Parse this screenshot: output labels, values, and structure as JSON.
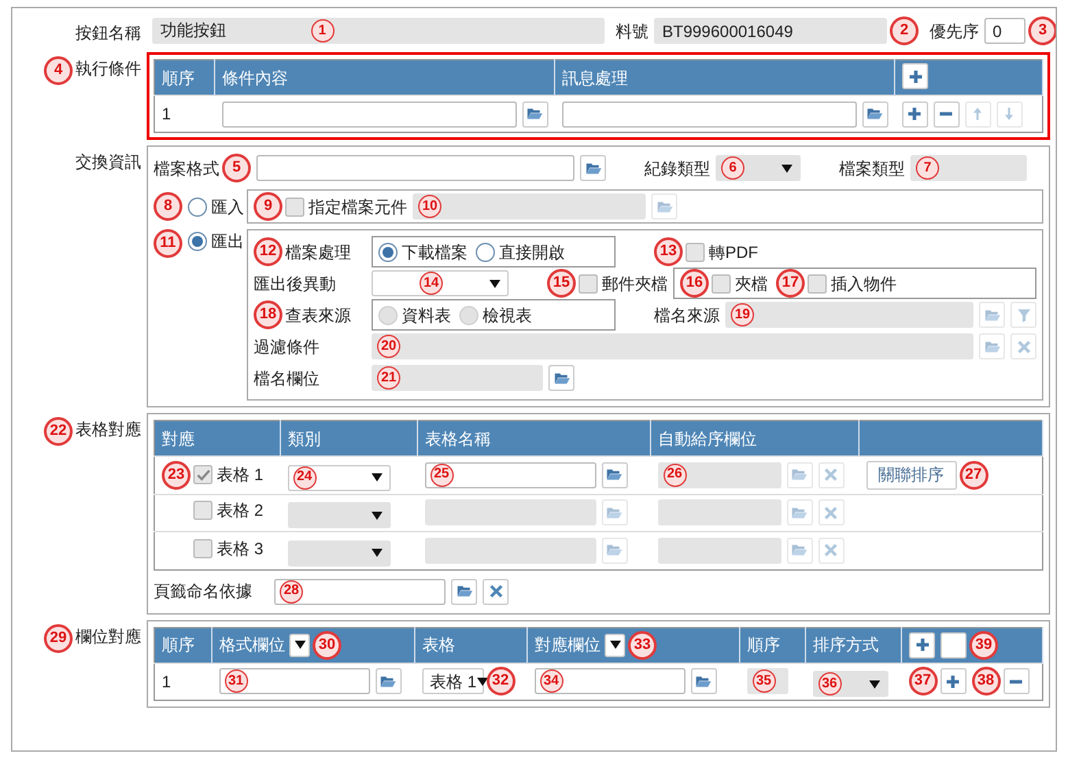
{
  "header": {
    "button_name": {
      "label": "按鈕名稱",
      "value": "功能按鈕",
      "callout": "1",
      "disabled": true
    },
    "item_no": {
      "label": "料號",
      "value": "BT999600016049",
      "callout": "2",
      "disabled": true
    },
    "priority": {
      "label": "優先序",
      "value": "0",
      "callout": "3",
      "disabled": false
    }
  },
  "conditions": {
    "label": "執行條件",
    "callout": "4",
    "columns": [
      "順序",
      "條件內容",
      "訊息處理"
    ],
    "rows": [
      {
        "seq": "1"
      }
    ]
  },
  "exchange": {
    "label": "交換資訊",
    "file_format": {
      "label": "檔案格式",
      "callout": "5"
    },
    "record_type": {
      "label": "紀錄類型",
      "callout": "6",
      "disabled": true
    },
    "file_type": {
      "label": "檔案類型",
      "callout": "7",
      "disabled": true
    },
    "import": {
      "label": "匯入",
      "selected": false,
      "callout": "8",
      "specify_doc": {
        "label": "指定檔案元件",
        "checked": false,
        "callout": "9"
      },
      "doc_field": {
        "callout": "10",
        "disabled": true
      }
    },
    "export": {
      "label": "匯出",
      "selected": true,
      "callout": "11",
      "file_handling": {
        "label": "檔案處理",
        "callout": "12",
        "options": [
          {
            "label": "下載檔案",
            "selected": true
          },
          {
            "label": "直接開啟",
            "selected": false
          }
        ]
      },
      "to_pdf": {
        "label": "轉PDF",
        "checked": false,
        "callout": "13"
      },
      "after_export": {
        "label": "匯出後異動",
        "callout": "14"
      },
      "mail_attach": {
        "label": "郵件夾檔",
        "checked": false,
        "callout": "15",
        "options": [
          {
            "label": "夾檔",
            "checked": false,
            "callout": "16"
          },
          {
            "label": "插入物件",
            "checked": false,
            "callout": "17"
          }
        ]
      },
      "lookup_source": {
        "label": "查表來源",
        "callout": "18",
        "disabled": true,
        "options": [
          {
            "label": "資料表",
            "selected": false
          },
          {
            "label": "檢視表",
            "selected": false
          }
        ]
      },
      "filename_source": {
        "label": "檔名來源",
        "callout": "19",
        "disabled": true
      },
      "filter": {
        "label": "過濾條件",
        "callout": "20",
        "disabled": true
      },
      "filename_field": {
        "label": "檔名欄位",
        "callout": "21",
        "disabled": true
      }
    }
  },
  "table_mapping": {
    "label": "表格對應",
    "callout": "22",
    "columns": [
      "對應",
      "類別",
      "表格名稱",
      "自動給序欄位"
    ],
    "rows": [
      {
        "label": "表格 1",
        "checked": true,
        "disabled": false,
        "link_button": "關聯排序",
        "callouts": [
          "23",
          "24",
          "25",
          "26",
          "27"
        ]
      },
      {
        "label": "表格 2",
        "checked": false,
        "disabled": true
      },
      {
        "label": "表格 3",
        "checked": false,
        "disabled": true
      }
    ],
    "tab_naming": {
      "label": "頁籤命名依據",
      "callout": "28"
    }
  },
  "field_mapping": {
    "label": "欄位對應",
    "callout": "29",
    "add_callout": "39",
    "columns": [
      {
        "label": "順序"
      },
      {
        "label": "格式欄位",
        "callout": "30"
      },
      {
        "label": "表格"
      },
      {
        "label": "對應欄位",
        "callout": "33"
      },
      {
        "label": "順序"
      },
      {
        "label": "排序方式"
      }
    ],
    "rows": [
      {
        "seq": "1",
        "table": "表格 1",
        "callouts": [
          "31",
          "32",
          "34",
          "35",
          "36",
          "37",
          "38"
        ]
      }
    ]
  }
}
